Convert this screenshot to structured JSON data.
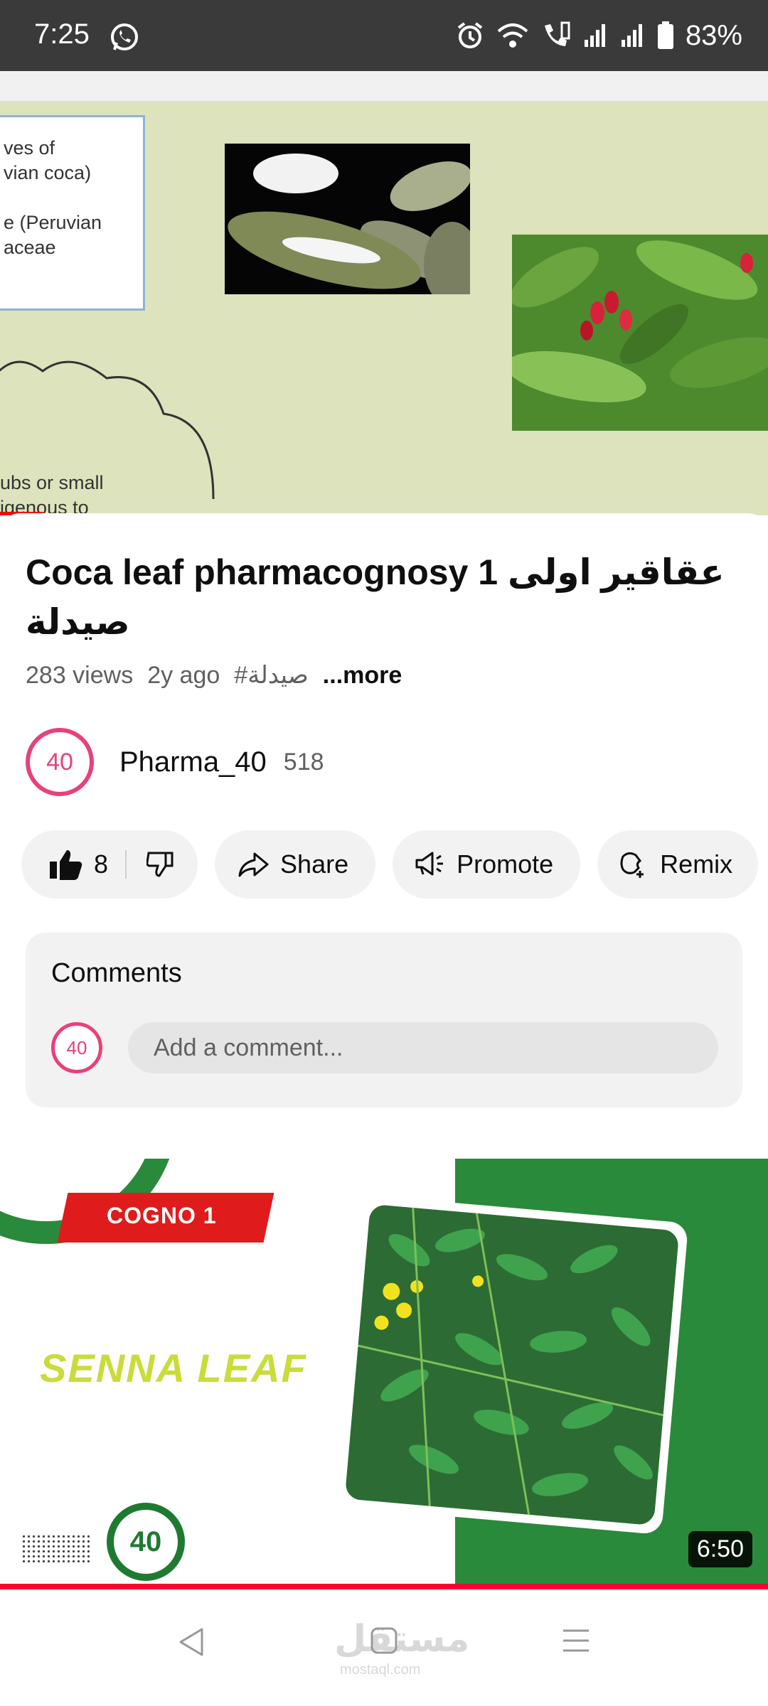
{
  "status_bar": {
    "time": "7:25",
    "battery": "83%",
    "icons": [
      "whatsapp-icon",
      "alarm-icon",
      "wifi-icon",
      "wifi-call-icon",
      "signal-icon",
      "signal-icon",
      "battery-icon"
    ]
  },
  "slide": {
    "box_lines": [
      "ves of",
      "vian coca)",
      "",
      "e (Peruvian",
      "aceae"
    ],
    "cloud_lines": [
      "ubs or small",
      "igenous to"
    ]
  },
  "video": {
    "title": "Coca leaf pharmacognosy 1 عقاقير اولى صيدلة",
    "views": "283 views",
    "age": "2y ago",
    "hashtag": "#صيدلة",
    "more": "...more"
  },
  "channel": {
    "avatar_text": "40",
    "name": "Pharma_40",
    "subscribers": "518"
  },
  "actions": {
    "likes": "8",
    "share": "Share",
    "promote": "Promote",
    "remix": "Remix"
  },
  "comments": {
    "title": "Comments",
    "avatar_text": "40",
    "placeholder": "Add a comment..."
  },
  "next_video": {
    "badge": "COGNO 1",
    "headline": "SENNA  LEAF",
    "logo": "40",
    "duration": "6:50"
  },
  "watermark": {
    "main": "مستقل",
    "sub": "mostaql.com"
  }
}
